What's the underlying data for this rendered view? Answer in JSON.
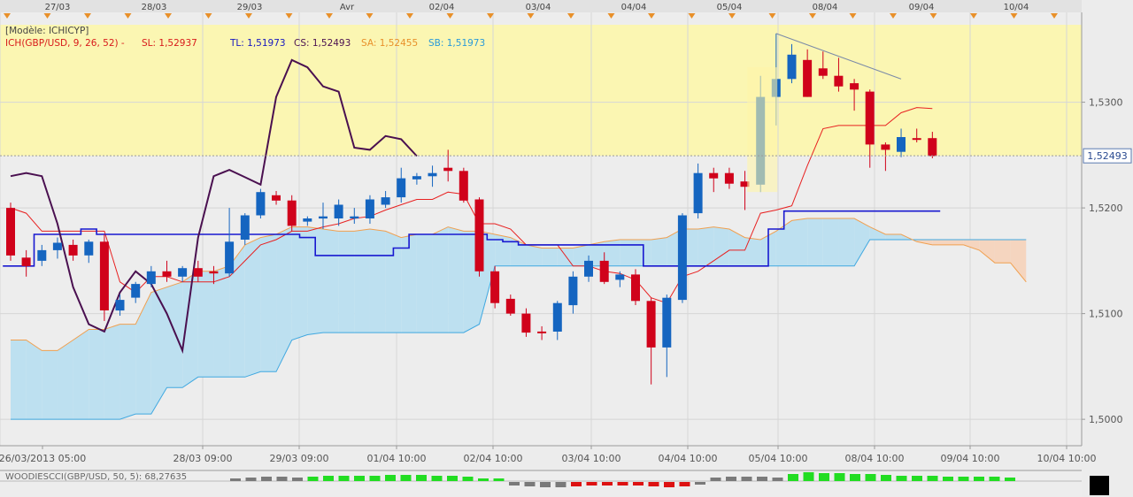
{
  "top_date_labels": [
    "27/03",
    "28/03",
    "29/03",
    "Avr",
    "02/04",
    "03/04",
    "04/04",
    "05/04",
    "08/04",
    "09/04",
    "10/04"
  ],
  "header": {
    "model": "[Modèle: ICHICYP]",
    "ich": "ICH(GBP/USD, 9, 26, 52) -",
    "sl": "SL: 1,52937",
    "tl": "TL: 1,51973",
    "cs": "CS: 1,52493",
    "sa": "SA: 1,52455",
    "sb": "SB: 1,51973"
  },
  "price_badge": "1,52493",
  "y_tick_labels": [
    "1,5300",
    "1,5200",
    "1,5100",
    "1,5000"
  ],
  "x_tick_labels": [
    "26/03/2013 05:00",
    "28/03 09:00",
    "29/03 09:00",
    "01/04 10:00",
    "02/04 10:00",
    "03/04 10:00",
    "04/04 10:00",
    "05/04 10:00",
    "08/04 10:00",
    "09/04 10:00",
    "10/04 10:00"
  ],
  "indicator_label": "WOODIESCCI(GBP/USD, 50, 5): 68,27635",
  "colors": {
    "bull": "#1565c0",
    "bear": "#d0021b",
    "cs_line": "#4a1050",
    "tenkan": "#e82020",
    "kijun": "#1818d0",
    "senkou_a": "#f0a050",
    "senkou_b": "#40a8e0",
    "cloud_bull": "#bde0f0",
    "cloud_bear": "#f5d5bf",
    "highlight": "#fff5a8",
    "cci_green": "#22dd22",
    "cci_gray": "#7a7a7a",
    "cci_red": "#dd1111"
  },
  "chart_data": {
    "type": "candlestick",
    "instrument": "GBP/USD",
    "ylim": [
      1.4975,
      1.5385
    ],
    "current_price": 1.52493,
    "y_ticks": [
      1.53,
      1.52,
      1.51,
      1.5
    ],
    "candles": [
      {
        "o": 1.52,
        "h": 1.5205,
        "l": 1.515,
        "c": 1.5155
      },
      {
        "o": 1.5153,
        "h": 1.516,
        "l": 1.5135,
        "c": 1.5145
      },
      {
        "o": 1.515,
        "h": 1.5165,
        "l": 1.5145,
        "c": 1.516
      },
      {
        "o": 1.516,
        "h": 1.5172,
        "l": 1.5152,
        "c": 1.5167
      },
      {
        "o": 1.5165,
        "h": 1.517,
        "l": 1.515,
        "c": 1.5155
      },
      {
        "o": 1.5155,
        "h": 1.517,
        "l": 1.5148,
        "c": 1.5168
      },
      {
        "o": 1.5168,
        "h": 1.5175,
        "l": 1.5093,
        "c": 1.5103
      },
      {
        "o": 1.5103,
        "h": 1.5118,
        "l": 1.5098,
        "c": 1.5113
      },
      {
        "o": 1.5115,
        "h": 1.513,
        "l": 1.511,
        "c": 1.5128
      },
      {
        "o": 1.5128,
        "h": 1.5145,
        "l": 1.5125,
        "c": 1.514
      },
      {
        "o": 1.514,
        "h": 1.515,
        "l": 1.513,
        "c": 1.5135
      },
      {
        "o": 1.5135,
        "h": 1.5145,
        "l": 1.513,
        "c": 1.5143
      },
      {
        "o": 1.5143,
        "h": 1.515,
        "l": 1.513,
        "c": 1.5135
      },
      {
        "o": 1.514,
        "h": 1.5145,
        "l": 1.5128,
        "c": 1.5138
      },
      {
        "o": 1.5138,
        "h": 1.52,
        "l": 1.5135,
        "c": 1.5168
      },
      {
        "o": 1.517,
        "h": 1.5195,
        "l": 1.5165,
        "c": 1.5193
      },
      {
        "o": 1.5193,
        "h": 1.5218,
        "l": 1.519,
        "c": 1.5215
      },
      {
        "o": 1.5212,
        "h": 1.5216,
        "l": 1.5203,
        "c": 1.5207
      },
      {
        "o": 1.5207,
        "h": 1.5212,
        "l": 1.5178,
        "c": 1.5183
      },
      {
        "o": 1.5187,
        "h": 1.5192,
        "l": 1.5183,
        "c": 1.519
      },
      {
        "o": 1.519,
        "h": 1.5205,
        "l": 1.518,
        "c": 1.5192
      },
      {
        "o": 1.519,
        "h": 1.5208,
        "l": 1.5183,
        "c": 1.5203
      },
      {
        "o": 1.519,
        "h": 1.52,
        "l": 1.5185,
        "c": 1.5192
      },
      {
        "o": 1.519,
        "h": 1.5212,
        "l": 1.5185,
        "c": 1.5208
      },
      {
        "o": 1.5203,
        "h": 1.5216,
        "l": 1.52,
        "c": 1.521
      },
      {
        "o": 1.521,
        "h": 1.5238,
        "l": 1.5205,
        "c": 1.5228
      },
      {
        "o": 1.5227,
        "h": 1.5233,
        "l": 1.5222,
        "c": 1.523
      },
      {
        "o": 1.523,
        "h": 1.524,
        "l": 1.522,
        "c": 1.5233
      },
      {
        "o": 1.5238,
        "h": 1.5255,
        "l": 1.5225,
        "c": 1.5235
      },
      {
        "o": 1.5235,
        "h": 1.5238,
        "l": 1.5205,
        "c": 1.5207
      },
      {
        "o": 1.5208,
        "h": 1.521,
        "l": 1.5135,
        "c": 1.514
      },
      {
        "o": 1.514,
        "h": 1.5145,
        "l": 1.5105,
        "c": 1.511
      },
      {
        "o": 1.5114,
        "h": 1.5118,
        "l": 1.5098,
        "c": 1.51
      },
      {
        "o": 1.51,
        "h": 1.5105,
        "l": 1.5078,
        "c": 1.5082
      },
      {
        "o": 1.5083,
        "h": 1.5088,
        "l": 1.5075,
        "c": 1.5082
      },
      {
        "o": 1.5083,
        "h": 1.5112,
        "l": 1.5075,
        "c": 1.511
      },
      {
        "o": 1.5108,
        "h": 1.514,
        "l": 1.51,
        "c": 1.5135
      },
      {
        "o": 1.5135,
        "h": 1.5155,
        "l": 1.513,
        "c": 1.515
      },
      {
        "o": 1.515,
        "h": 1.5158,
        "l": 1.5128,
        "c": 1.513
      },
      {
        "o": 1.5132,
        "h": 1.514,
        "l": 1.5125,
        "c": 1.5137
      },
      {
        "o": 1.5137,
        "h": 1.5142,
        "l": 1.5108,
        "c": 1.5112
      },
      {
        "o": 1.5112,
        "h": 1.5115,
        "l": 1.5033,
        "c": 1.5068
      },
      {
        "o": 1.5068,
        "h": 1.5118,
        "l": 1.504,
        "c": 1.5115
      },
      {
        "o": 1.5113,
        "h": 1.5195,
        "l": 1.511,
        "c": 1.5193
      },
      {
        "o": 1.5195,
        "h": 1.5242,
        "l": 1.519,
        "c": 1.5233
      },
      {
        "o": 1.5233,
        "h": 1.5238,
        "l": 1.5215,
        "c": 1.5228
      },
      {
        "o": 1.5233,
        "h": 1.5238,
        "l": 1.5218,
        "c": 1.5223
      },
      {
        "o": 1.5225,
        "h": 1.5235,
        "l": 1.5198,
        "c": 1.522
      },
      {
        "o": 1.5222,
        "h": 1.5325,
        "l": 1.5215,
        "c": 1.5305
      },
      {
        "o": 1.5305,
        "h": 1.5365,
        "l": 1.5278,
        "c": 1.5322
      },
      {
        "o": 1.5322,
        "h": 1.5355,
        "l": 1.5318,
        "c": 1.5345
      },
      {
        "o": 1.534,
        "h": 1.535,
        "l": 1.5305,
        "c": 1.5305
      },
      {
        "o": 1.5332,
        "h": 1.5348,
        "l": 1.5322,
        "c": 1.5325
      },
      {
        "o": 1.5325,
        "h": 1.5342,
        "l": 1.531,
        "c": 1.5315
      },
      {
        "o": 1.5318,
        "h": 1.5322,
        "l": 1.5292,
        "c": 1.5312
      },
      {
        "o": 1.531,
        "h": 1.5312,
        "l": 1.5238,
        "c": 1.526
      },
      {
        "o": 1.526,
        "h": 1.5262,
        "l": 1.5235,
        "c": 1.5255
      },
      {
        "o": 1.5253,
        "h": 1.5275,
        "l": 1.5248,
        "c": 1.5267
      },
      {
        "o": 1.5266,
        "h": 1.5275,
        "l": 1.5262,
        "c": 1.5265
      },
      {
        "o": 1.5266,
        "h": 1.5272,
        "l": 1.5247,
        "c": 1.5249
      }
    ],
    "tenkan": [
      1.52,
      1.5195,
      1.5178,
      1.5178,
      1.5178,
      1.5178,
      1.5178,
      1.513,
      1.512,
      1.5135,
      1.5135,
      1.513,
      1.513,
      1.513,
      1.5135,
      1.515,
      1.5165,
      1.517,
      1.5178,
      1.5178,
      1.5182,
      1.5185,
      1.519,
      1.5192,
      1.5198,
      1.5203,
      1.5208,
      1.5208,
      1.5215,
      1.5213,
      1.5185,
      1.5185,
      1.518,
      1.5165,
      1.5165,
      1.5165,
      1.5145,
      1.5145,
      1.514,
      1.5138,
      1.5132,
      1.5115,
      1.511,
      1.5135,
      1.514,
      1.515,
      1.516,
      1.516,
      1.5195,
      1.5198,
      1.5202,
      1.524,
      1.5275,
      1.5278,
      1.5278,
      1.5278,
      1.5278,
      1.529,
      1.5295,
      1.5294
    ],
    "kijun": [
      1.5145,
      1.5145,
      1.5175,
      1.5175,
      1.5175,
      1.518,
      1.5175,
      1.5175,
      1.5175,
      1.5175,
      1.5175,
      1.5175,
      1.5175,
      1.5175,
      1.5175,
      1.5175,
      1.5175,
      1.5175,
      1.5175,
      1.5172,
      1.5155,
      1.5155,
      1.5155,
      1.5155,
      1.5155,
      1.5162,
      1.5175,
      1.5175,
      1.5175,
      1.5175,
      1.5175,
      1.517,
      1.5168,
      1.5165,
      1.5165,
      1.5165,
      1.5165,
      1.5165,
      1.5165,
      1.5165,
      1.5165,
      1.5145,
      1.5145,
      1.5145,
      1.5145,
      1.5145,
      1.5145,
      1.5145,
      1.5145,
      1.518,
      1.5197,
      1.5197,
      1.5197,
      1.5197,
      1.5197,
      1.5197,
      1.5197,
      1.5197,
      1.5197,
      1.5197
    ],
    "chikou": [
      1.523,
      1.5233,
      1.523,
      1.5185,
      1.5125,
      1.509,
      1.5083,
      1.512,
      1.514,
      1.5128,
      1.51,
      1.5065,
      1.5172,
      1.523,
      1.5236,
      1.5229,
      1.5222,
      1.5305,
      1.534,
      1.5333,
      1.5315,
      1.531,
      1.5257,
      1.5255,
      1.5268,
      1.5265,
      1.5249
    ],
    "senkou_a": [
      1.5075,
      1.5075,
      1.5065,
      1.5065,
      1.5075,
      1.5085,
      1.5085,
      1.509,
      1.509,
      1.512,
      1.5125,
      1.513,
      1.514,
      1.514,
      1.5145,
      1.5165,
      1.5172,
      1.5175,
      1.5182,
      1.5182,
      1.518,
      1.5178,
      1.5178,
      1.518,
      1.5178,
      1.5172,
      1.5175,
      1.5175,
      1.5182,
      1.5178,
      1.5178,
      1.5175,
      1.5172,
      1.5165,
      1.5162,
      1.5162,
      1.5162,
      1.5165,
      1.5168,
      1.517,
      1.517,
      1.517,
      1.5172,
      1.518,
      1.518,
      1.5182,
      1.518,
      1.5172,
      1.517,
      1.5178,
      1.5188,
      1.519,
      1.519,
      1.519,
      1.519,
      1.5182,
      1.5175,
      1.5175,
      1.5168,
      1.5165,
      1.5165,
      1.5165,
      1.516,
      1.5148,
      1.5148,
      1.513
    ],
    "senkou_b": [
      1.5,
      1.5,
      1.5,
      1.5,
      1.5,
      1.5,
      1.5,
      1.5,
      1.5005,
      1.5005,
      1.503,
      1.503,
      1.504,
      1.504,
      1.504,
      1.504,
      1.5045,
      1.5045,
      1.5075,
      1.508,
      1.5082,
      1.5082,
      1.5082,
      1.5082,
      1.5082,
      1.5082,
      1.5082,
      1.5082,
      1.5082,
      1.5082,
      1.509,
      1.5145,
      1.5145,
      1.5145,
      1.5145,
      1.5145,
      1.5145,
      1.5145,
      1.5145,
      1.5145,
      1.5145,
      1.5145,
      1.5145,
      1.5145,
      1.5145,
      1.5145,
      1.5145,
      1.5145,
      1.5145,
      1.5145,
      1.5145,
      1.5145,
      1.5145,
      1.5145,
      1.5145,
      1.517,
      1.517,
      1.517,
      1.517,
      1.517,
      1.517,
      1.517,
      1.517,
      1.517,
      1.517,
      1.517
    ],
    "trendline": [
      1.5365,
      1.5322
    ],
    "cci_histogram": [
      {
        "v": 3,
        "c": "gray"
      },
      {
        "v": 4,
        "c": "gray"
      },
      {
        "v": 5,
        "c": "gray"
      },
      {
        "v": 5,
        "c": "gray"
      },
      {
        "v": 4,
        "c": "gray"
      },
      {
        "v": 5,
        "c": "green"
      },
      {
        "v": 6,
        "c": "green"
      },
      {
        "v": 6,
        "c": "green"
      },
      {
        "v": 6,
        "c": "green"
      },
      {
        "v": 6,
        "c": "green"
      },
      {
        "v": 7,
        "c": "green"
      },
      {
        "v": 7,
        "c": "green"
      },
      {
        "v": 7,
        "c": "green"
      },
      {
        "v": 6,
        "c": "green"
      },
      {
        "v": 6,
        "c": "green"
      },
      {
        "v": 5,
        "c": "green"
      },
      {
        "v": 3,
        "c": "green"
      },
      {
        "v": 3,
        "c": "green"
      },
      {
        "v": -4,
        "c": "gray"
      },
      {
        "v": -5,
        "c": "gray"
      },
      {
        "v": -6,
        "c": "gray"
      },
      {
        "v": -6,
        "c": "gray"
      },
      {
        "v": -5,
        "c": "red"
      },
      {
        "v": -4,
        "c": "red"
      },
      {
        "v": -4,
        "c": "red"
      },
      {
        "v": -4,
        "c": "red"
      },
      {
        "v": -4,
        "c": "red"
      },
      {
        "v": -5,
        "c": "red"
      },
      {
        "v": -6,
        "c": "red"
      },
      {
        "v": -5,
        "c": "red"
      },
      {
        "v": -3,
        "c": "gray"
      },
      {
        "v": 4,
        "c": "gray"
      },
      {
        "v": 5,
        "c": "gray"
      },
      {
        "v": 5,
        "c": "gray"
      },
      {
        "v": 5,
        "c": "gray"
      },
      {
        "v": 4,
        "c": "gray"
      },
      {
        "v": 8,
        "c": "green"
      },
      {
        "v": 10,
        "c": "green"
      },
      {
        "v": 9,
        "c": "green"
      },
      {
        "v": 9,
        "c": "green"
      },
      {
        "v": 8,
        "c": "green"
      },
      {
        "v": 8,
        "c": "green"
      },
      {
        "v": 7,
        "c": "green"
      },
      {
        "v": 6,
        "c": "green"
      },
      {
        "v": 6,
        "c": "green"
      },
      {
        "v": 6,
        "c": "green"
      },
      {
        "v": 5,
        "c": "green"
      },
      {
        "v": 5,
        "c": "green"
      },
      {
        "v": 5,
        "c": "green"
      },
      {
        "v": 5,
        "c": "green"
      },
      {
        "v": 4,
        "c": "green"
      }
    ]
  }
}
